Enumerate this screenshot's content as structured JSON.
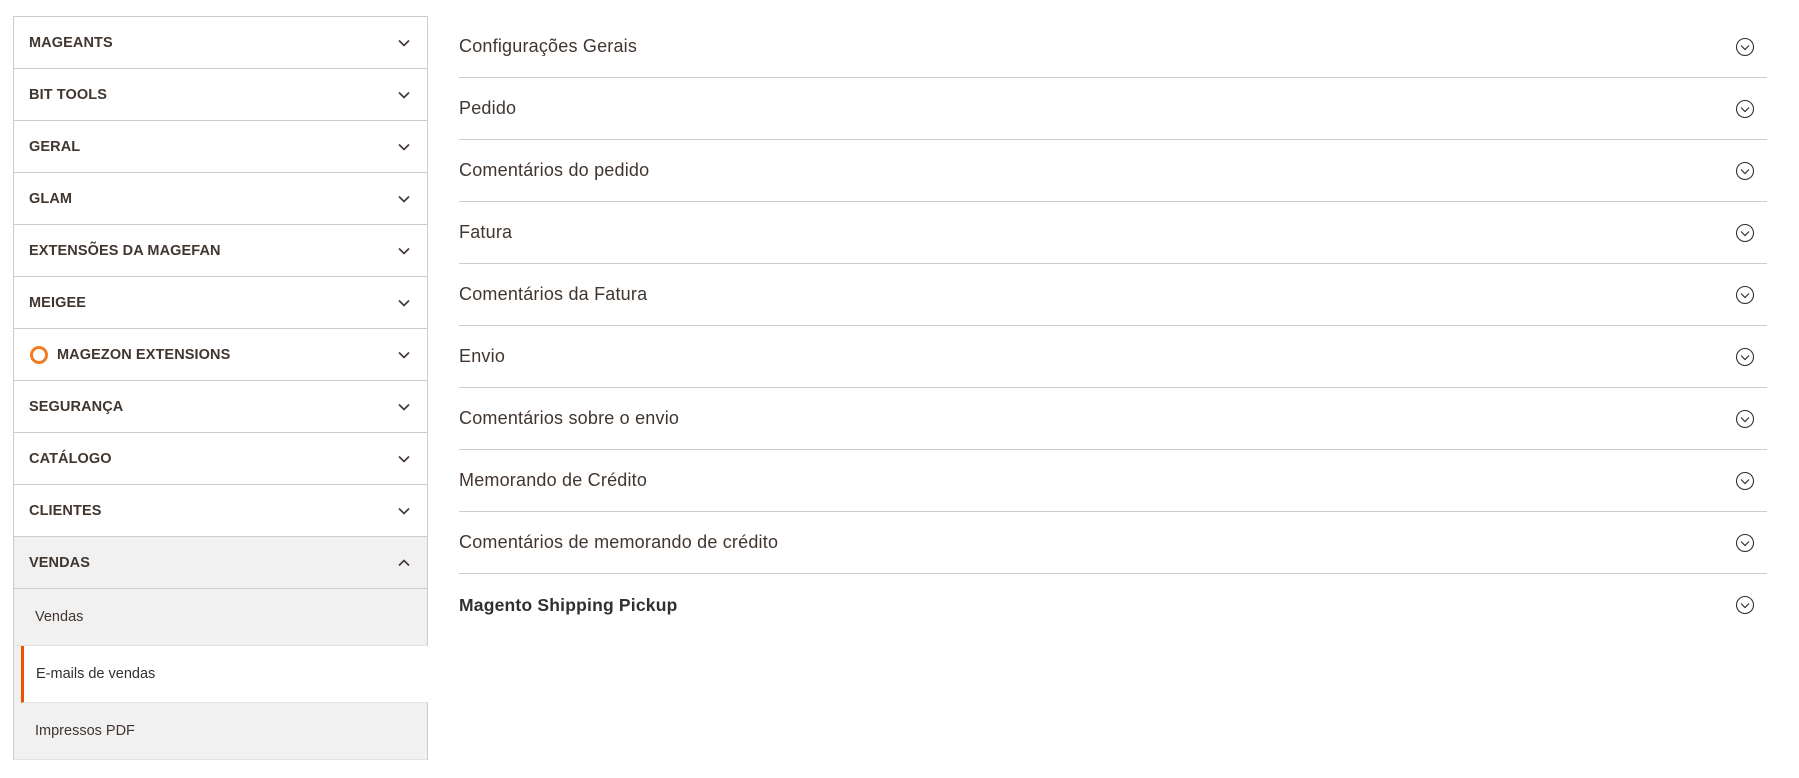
{
  "sidebar": {
    "groups": [
      {
        "label": "MAGEANTS"
      },
      {
        "label": "BIT TOOLS"
      },
      {
        "label": "GERAL"
      },
      {
        "label": "GLAM"
      },
      {
        "label": "EXTENSÕES DA MAGEFAN"
      },
      {
        "label": "MEIGEE"
      },
      {
        "label": "MAGEZON EXTENSIONS"
      },
      {
        "label": "SEGURANÇA"
      },
      {
        "label": "CATÁLOGO"
      },
      {
        "label": "CLIENTES"
      },
      {
        "label": "VENDAS"
      }
    ],
    "vendas_subitems": [
      {
        "label": "Vendas"
      },
      {
        "label": "E-mails de vendas"
      },
      {
        "label": "Impressos PDF"
      }
    ],
    "active_subitem": "E-mails de vendas",
    "accent_color": "#eb5202",
    "magezon_logo_color": "#f47b20"
  },
  "main": {
    "sections": [
      {
        "title": "Configurações Gerais"
      },
      {
        "title": "Pedido"
      },
      {
        "title": "Comentários do pedido"
      },
      {
        "title": "Fatura"
      },
      {
        "title": "Comentários da Fatura"
      },
      {
        "title": "Envio"
      },
      {
        "title": "Comentários sobre o envio"
      },
      {
        "title": "Memorando de Crédito"
      },
      {
        "title": "Comentários de memorando de crédito"
      },
      {
        "title": "Magento Shipping Pickup"
      }
    ],
    "expand_icon": "circle-chevron-down-icon"
  }
}
